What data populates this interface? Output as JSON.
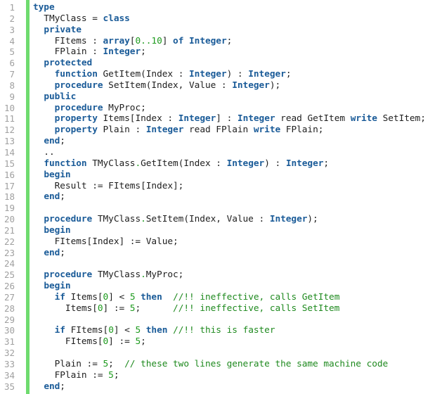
{
  "editor": {
    "language": "Pascal",
    "colors": {
      "keyword": "#1a5b98",
      "number": "#1d9a1d",
      "comment": "#1f8a1f",
      "text": "#1e1e1e",
      "line_number": "#a0a0a0",
      "gutter_bar": "#6edb6e"
    },
    "lines": [
      {
        "n": "1",
        "tokens": [
          [
            "kw",
            "type"
          ]
        ]
      },
      {
        "n": "2",
        "tokens": [
          [
            "tx",
            "  TMyClass = "
          ],
          [
            "kw",
            "class"
          ]
        ]
      },
      {
        "n": "3",
        "tokens": [
          [
            "tx",
            "  "
          ],
          [
            "kw",
            "private"
          ]
        ]
      },
      {
        "n": "4",
        "tokens": [
          [
            "tx",
            "    FItems : "
          ],
          [
            "kw",
            "array"
          ],
          [
            "tx",
            "["
          ],
          [
            "num",
            "0..10"
          ],
          [
            "tx",
            "] "
          ],
          [
            "kw",
            "of"
          ],
          [
            "tx",
            " "
          ],
          [
            "kw",
            "Integer"
          ],
          [
            "tx",
            ";"
          ]
        ]
      },
      {
        "n": "5",
        "tokens": [
          [
            "tx",
            "    FPlain : "
          ],
          [
            "kw",
            "Integer"
          ],
          [
            "tx",
            ";"
          ]
        ]
      },
      {
        "n": "6",
        "tokens": [
          [
            "tx",
            "  "
          ],
          [
            "kw",
            "protected"
          ]
        ]
      },
      {
        "n": "7",
        "tokens": [
          [
            "tx",
            "    "
          ],
          [
            "kw",
            "function"
          ],
          [
            "tx",
            " GetItem(Index : "
          ],
          [
            "kw",
            "Integer"
          ],
          [
            "tx",
            ") : "
          ],
          [
            "kw",
            "Integer"
          ],
          [
            "tx",
            ";"
          ]
        ]
      },
      {
        "n": "8",
        "tokens": [
          [
            "tx",
            "    "
          ],
          [
            "kw",
            "procedure"
          ],
          [
            "tx",
            " SetItem(Index, Value : "
          ],
          [
            "kw",
            "Integer"
          ],
          [
            "tx",
            ");"
          ]
        ]
      },
      {
        "n": "9",
        "tokens": [
          [
            "tx",
            "  "
          ],
          [
            "kw",
            "public"
          ]
        ]
      },
      {
        "n": "10",
        "tokens": [
          [
            "tx",
            "    "
          ],
          [
            "kw",
            "procedure"
          ],
          [
            "tx",
            " MyProc;"
          ]
        ]
      },
      {
        "n": "11",
        "tokens": [
          [
            "tx",
            "    "
          ],
          [
            "kw",
            "property"
          ],
          [
            "tx",
            " Items[Index : "
          ],
          [
            "kw",
            "Integer"
          ],
          [
            "tx",
            "] : "
          ],
          [
            "kw",
            "Integer"
          ],
          [
            "tx",
            " read GetItem "
          ],
          [
            "kw",
            "write"
          ],
          [
            "tx",
            " SetItem;"
          ]
        ]
      },
      {
        "n": "12",
        "tokens": [
          [
            "tx",
            "    "
          ],
          [
            "kw",
            "property"
          ],
          [
            "tx",
            " Plain : "
          ],
          [
            "kw",
            "Integer"
          ],
          [
            "tx",
            " read FPlain "
          ],
          [
            "kw",
            "write"
          ],
          [
            "tx",
            " FPlain;"
          ]
        ]
      },
      {
        "n": "13",
        "tokens": [
          [
            "tx",
            "  "
          ],
          [
            "kw",
            "end"
          ],
          [
            "tx",
            ";"
          ]
        ]
      },
      {
        "n": "14",
        "tokens": [
          [
            "tx",
            "  .."
          ]
        ]
      },
      {
        "n": "15",
        "tokens": [
          [
            "tx",
            "  "
          ],
          [
            "kw",
            "function"
          ],
          [
            "tx",
            " TMyClass"
          ],
          [
            "sym",
            "."
          ],
          [
            "tx",
            "GetItem(Index : "
          ],
          [
            "kw",
            "Integer"
          ],
          [
            "tx",
            ") : "
          ],
          [
            "kw",
            "Integer"
          ],
          [
            "tx",
            ";"
          ]
        ]
      },
      {
        "n": "16",
        "tokens": [
          [
            "tx",
            "  "
          ],
          [
            "kw",
            "begin"
          ]
        ]
      },
      {
        "n": "17",
        "tokens": [
          [
            "tx",
            "    Result := FItems[Index];"
          ]
        ]
      },
      {
        "n": "18",
        "tokens": [
          [
            "tx",
            "  "
          ],
          [
            "kw",
            "end"
          ],
          [
            "tx",
            ";"
          ]
        ]
      },
      {
        "n": "19",
        "tokens": []
      },
      {
        "n": "20",
        "tokens": [
          [
            "tx",
            "  "
          ],
          [
            "kw",
            "procedure"
          ],
          [
            "tx",
            " TMyClass"
          ],
          [
            "sym",
            "."
          ],
          [
            "tx",
            "SetItem(Index, Value : "
          ],
          [
            "kw",
            "Integer"
          ],
          [
            "tx",
            ");"
          ]
        ]
      },
      {
        "n": "21",
        "tokens": [
          [
            "tx",
            "  "
          ],
          [
            "kw",
            "begin"
          ]
        ]
      },
      {
        "n": "22",
        "tokens": [
          [
            "tx",
            "    FItems[Index] := Value;"
          ]
        ]
      },
      {
        "n": "23",
        "tokens": [
          [
            "tx",
            "  "
          ],
          [
            "kw",
            "end"
          ],
          [
            "tx",
            ";"
          ]
        ]
      },
      {
        "n": "24",
        "tokens": []
      },
      {
        "n": "25",
        "tokens": [
          [
            "tx",
            "  "
          ],
          [
            "kw",
            "procedure"
          ],
          [
            "tx",
            " TMyClass"
          ],
          [
            "sym",
            "."
          ],
          [
            "tx",
            "MyProc;"
          ]
        ]
      },
      {
        "n": "26",
        "tokens": [
          [
            "tx",
            "  "
          ],
          [
            "kw",
            "begin"
          ]
        ]
      },
      {
        "n": "27",
        "tokens": [
          [
            "tx",
            "    "
          ],
          [
            "kw",
            "if"
          ],
          [
            "tx",
            " Items["
          ],
          [
            "num",
            "0"
          ],
          [
            "tx",
            "] < "
          ],
          [
            "num",
            "5"
          ],
          [
            "tx",
            " "
          ],
          [
            "kw",
            "then"
          ],
          [
            "tx",
            "  "
          ],
          [
            "cm",
            "//!! ineffective, calls GetItem"
          ]
        ]
      },
      {
        "n": "28",
        "tokens": [
          [
            "tx",
            "      Items["
          ],
          [
            "num",
            "0"
          ],
          [
            "tx",
            "] := "
          ],
          [
            "num",
            "5"
          ],
          [
            "tx",
            ";      "
          ],
          [
            "cm",
            "//!! ineffective, calls SetItem"
          ]
        ]
      },
      {
        "n": "29",
        "tokens": []
      },
      {
        "n": "30",
        "tokens": [
          [
            "tx",
            "    "
          ],
          [
            "kw",
            "if"
          ],
          [
            "tx",
            " FItems["
          ],
          [
            "num",
            "0"
          ],
          [
            "tx",
            "] < "
          ],
          [
            "num",
            "5"
          ],
          [
            "tx",
            " "
          ],
          [
            "kw",
            "then"
          ],
          [
            "tx",
            " "
          ],
          [
            "cm",
            "//!! this is faster"
          ]
        ]
      },
      {
        "n": "31",
        "tokens": [
          [
            "tx",
            "      FItems["
          ],
          [
            "num",
            "0"
          ],
          [
            "tx",
            "] := "
          ],
          [
            "num",
            "5"
          ],
          [
            "tx",
            ";"
          ]
        ]
      },
      {
        "n": "32",
        "tokens": []
      },
      {
        "n": "33",
        "tokens": [
          [
            "tx",
            "    Plain := "
          ],
          [
            "num",
            "5"
          ],
          [
            "tx",
            ";  "
          ],
          [
            "cm",
            "// these two lines generate the same machine code"
          ]
        ]
      },
      {
        "n": "34",
        "tokens": [
          [
            "tx",
            "    FPlain := "
          ],
          [
            "num",
            "5"
          ],
          [
            "tx",
            ";"
          ]
        ]
      },
      {
        "n": "35",
        "tokens": [
          [
            "tx",
            "  "
          ],
          [
            "kw",
            "end"
          ],
          [
            "tx",
            ";"
          ]
        ]
      }
    ]
  }
}
